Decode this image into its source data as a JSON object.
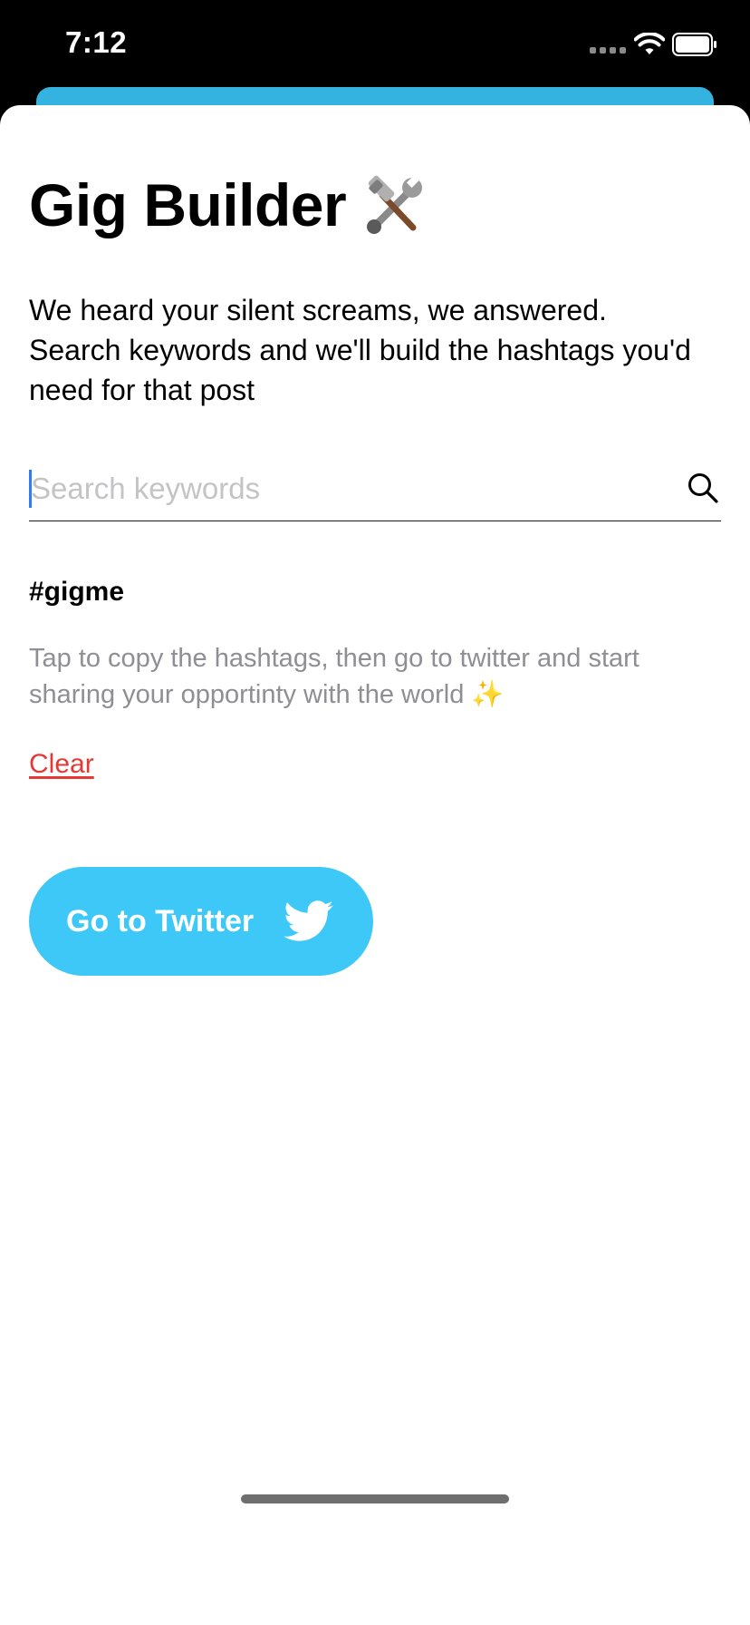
{
  "status_bar": {
    "time": "7:12"
  },
  "header": {
    "title": "Gig Builder",
    "title_icon": "hammer-and-wrench-icon"
  },
  "description": "We heard your silent screams, we answered. Search keywords and we'll build the hashtags you'd need for that post",
  "search": {
    "placeholder": "Search keywords",
    "value": "",
    "icon": "search-icon"
  },
  "hashtags": "#gigme",
  "hint": {
    "text": "Tap to copy the hashtags, then go to twitter and start sharing your opportinty with the world",
    "emoji": "✨"
  },
  "clear_label": "Clear",
  "twitter_button": {
    "label": "Go to Twitter",
    "icon": "twitter-bird-icon"
  },
  "colors": {
    "accent": "#3ec8f8",
    "underlying_sheet": "#34b3e0",
    "clear": "#e53935",
    "hint_text": "#8e8e93",
    "caret": "#2f7cf6"
  }
}
